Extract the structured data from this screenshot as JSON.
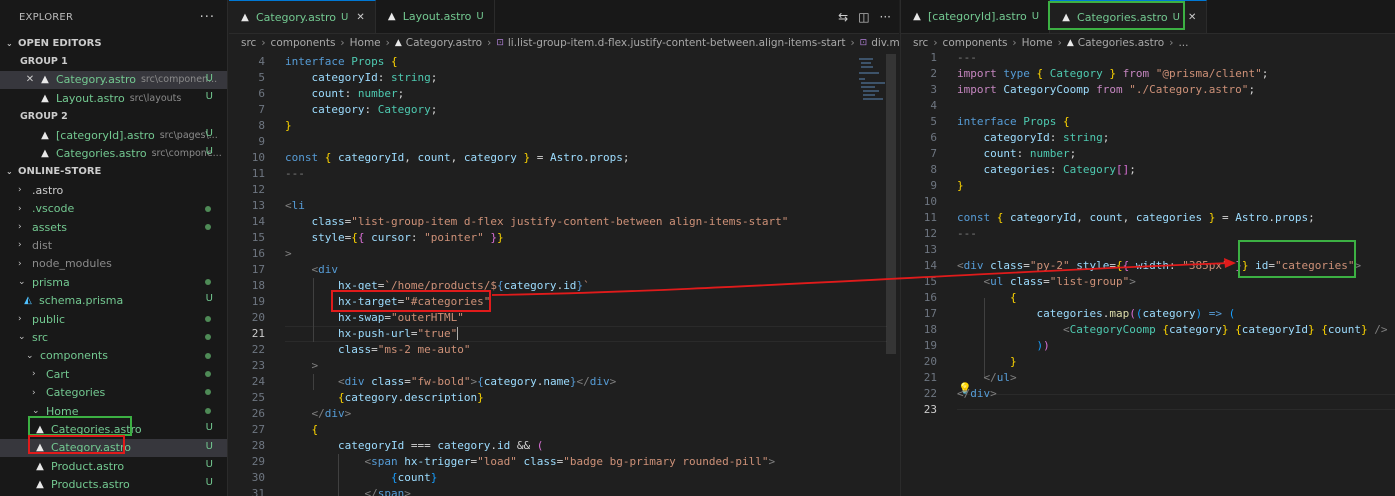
{
  "sidebar": {
    "title": "EXPLORER",
    "more_icon": "ellipsis-icon",
    "open_editors": {
      "label": "OPEN EDITORS",
      "group1": {
        "label": "GROUP 1",
        "items": [
          {
            "name": "Category.astro",
            "path": "src\\componen...",
            "status": "U",
            "close": "✕"
          },
          {
            "name": "Layout.astro",
            "path": "src\\layouts",
            "status": "U"
          }
        ]
      },
      "group2": {
        "label": "GROUP 2",
        "items": [
          {
            "name": "[categoryId].astro",
            "path": "src\\pages\\...",
            "status": "U"
          },
          {
            "name": "Categories.astro",
            "path": "src\\compone...",
            "status": "U"
          }
        ]
      }
    },
    "project": {
      "label": "ONLINE-STORE",
      "items": [
        {
          "name": ".astro"
        },
        {
          "name": ".vscode"
        },
        {
          "name": "assets"
        },
        {
          "name": "dist"
        },
        {
          "name": "node_modules"
        },
        {
          "name": "prisma"
        },
        {
          "name": "schema.prisma",
          "status": "U"
        },
        {
          "name": "public"
        },
        {
          "name": "src"
        },
        {
          "name": "components"
        },
        {
          "name": "Cart"
        },
        {
          "name": "Categories"
        },
        {
          "name": "Home"
        },
        {
          "name": "Categories.astro",
          "status": "U"
        },
        {
          "name": "Category.astro",
          "status": "U"
        },
        {
          "name": "Product.astro",
          "status": "U"
        },
        {
          "name": "Products.astro",
          "status": "U"
        }
      ]
    }
  },
  "editor1": {
    "tabs": [
      {
        "name": "Category.astro",
        "status": "U",
        "close": "✕"
      },
      {
        "name": "Layout.astro",
        "status": "U"
      }
    ],
    "breadcrumb": [
      "src",
      "components",
      "Home",
      "Category.astro",
      "li.list-group-item.d-flex.justify-content-between.align-items-start",
      "div.ms-2.me"
    ],
    "lines": [
      "4",
      "5",
      "6",
      "7",
      "8",
      "9",
      "10",
      "11",
      "12",
      "13",
      "14",
      "15",
      "16",
      "17",
      "18",
      "19",
      "20",
      "21",
      "22",
      "23",
      "24",
      "25",
      "26",
      "27",
      "28",
      "29",
      "30",
      "31"
    ],
    "current_line": "21"
  },
  "editor2": {
    "tabs": [
      {
        "name": "[categoryId].astro",
        "status": "U"
      },
      {
        "name": "Categories.astro",
        "status": "U",
        "close": "✕"
      }
    ],
    "breadcrumb": [
      "src",
      "components",
      "Home",
      "Categories.astro",
      "..."
    ],
    "lines": [
      "1",
      "2",
      "3",
      "4",
      "5",
      "6",
      "7",
      "8",
      "9",
      "10",
      "11",
      "12",
      "13",
      "14",
      "15",
      "16",
      "17",
      "18",
      "19",
      "20",
      "21",
      "22",
      "23"
    ]
  },
  "colors": {
    "accent": "#0078d4",
    "untracked": "#73c991",
    "annotation_red": "#e01b1b",
    "annotation_green": "#3cb043"
  }
}
